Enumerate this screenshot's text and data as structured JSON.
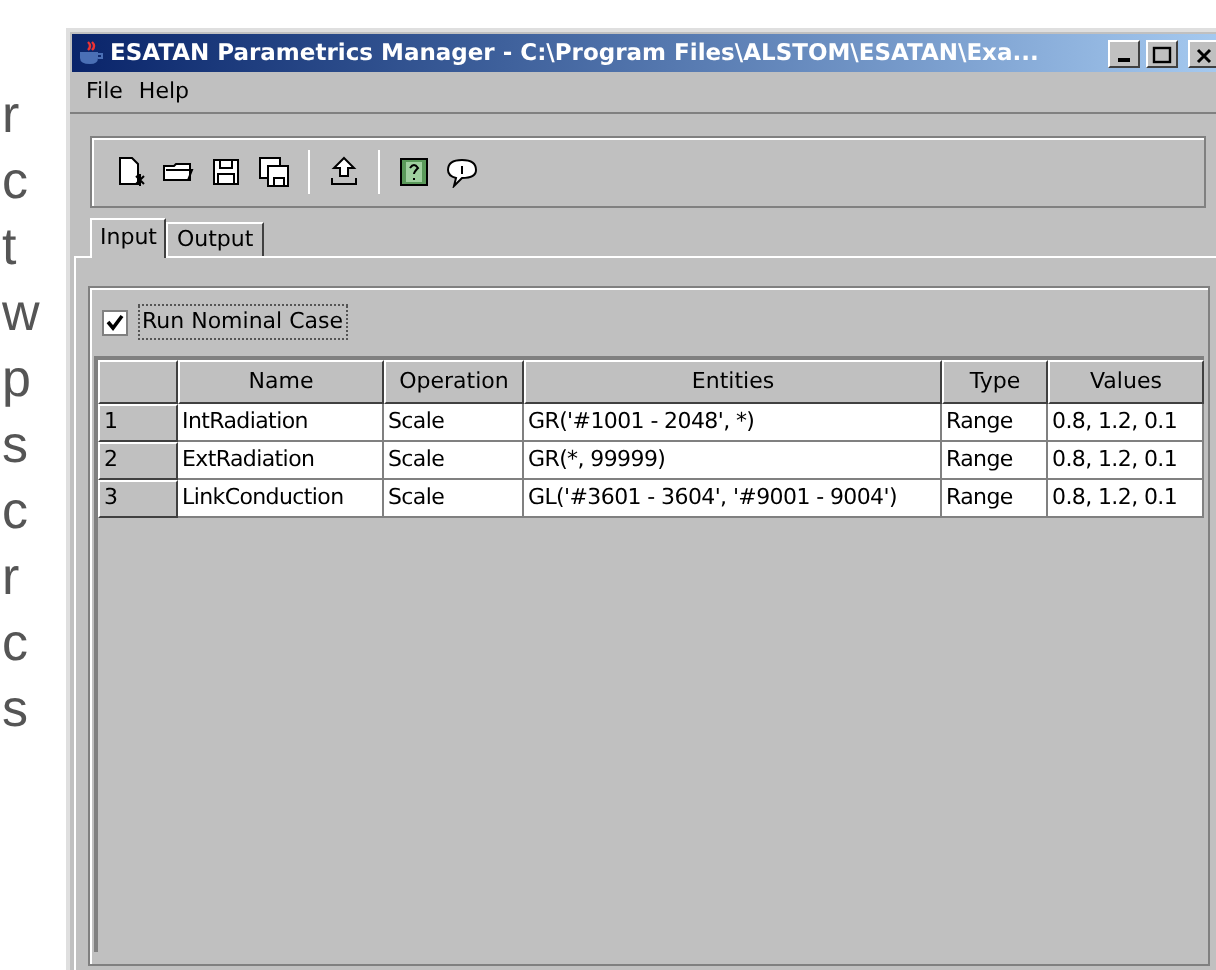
{
  "background_document": {
    "fragments": [
      "r",
      "c",
      "t",
      "w",
      "p",
      "s",
      "c",
      "r",
      "c",
      "s"
    ]
  },
  "window": {
    "title": "ESATAN Parametrics Manager - C:\\Program Files\\ALSTOM\\ESATAN\\Exa..."
  },
  "menu": [
    "File",
    "Help"
  ],
  "tabs": [
    {
      "label": "Input",
      "selected": true
    },
    {
      "label": "Output",
      "selected": false
    }
  ],
  "run_nominal_case": {
    "label": "Run Nominal Case",
    "checked": true
  },
  "table": {
    "columns": [
      "Name",
      "Operation",
      "Entities",
      "Type",
      "Values"
    ],
    "rows": [
      {
        "index": "1",
        "cells": [
          "IntRadiation",
          "Scale",
          "GR('#1001 - 2048', *)",
          "Range",
          "0.8, 1.2, 0.1"
        ]
      },
      {
        "index": "2",
        "cells": [
          "ExtRadiation",
          "Scale",
          "GR(*, 99999)",
          "Range",
          "0.8, 1.2, 0.1"
        ]
      },
      {
        "index": "3",
        "cells": [
          "LinkConduction",
          "Scale",
          "GL('#3601 - 3604', '#9001 - 9004')",
          "Range",
          "0.8, 1.2, 0.1"
        ]
      }
    ]
  }
}
